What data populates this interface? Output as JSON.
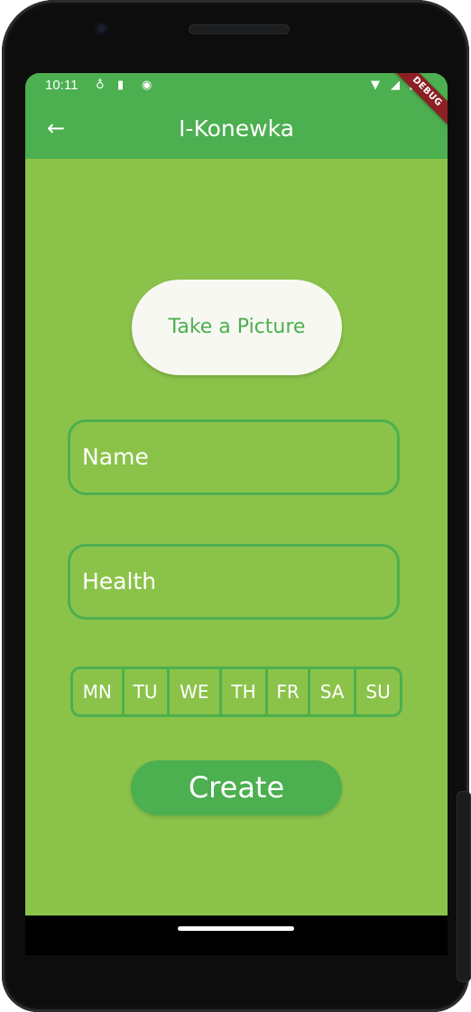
{
  "status_bar": {
    "time": "10:11",
    "left_icons": [
      "usb-icon",
      "sd-card-icon",
      "sync-icon"
    ],
    "right_icons": [
      "wifi-icon",
      "signal-icon",
      "battery-icon"
    ]
  },
  "app_bar": {
    "title": "I-Konewka",
    "back_icon": "arrow-back-icon"
  },
  "debug_banner": "DEBUG",
  "form": {
    "picture_button_label": "Take a Picture",
    "name_label": "Name",
    "health_label": "Health",
    "days": [
      "MN",
      "TU",
      "WE",
      "TH",
      "FR",
      "SA",
      "SU"
    ],
    "create_button_label": "Create"
  },
  "colors": {
    "primary": "#4caf50",
    "background": "#8bc34a",
    "button_light": "#f7f8f1"
  }
}
